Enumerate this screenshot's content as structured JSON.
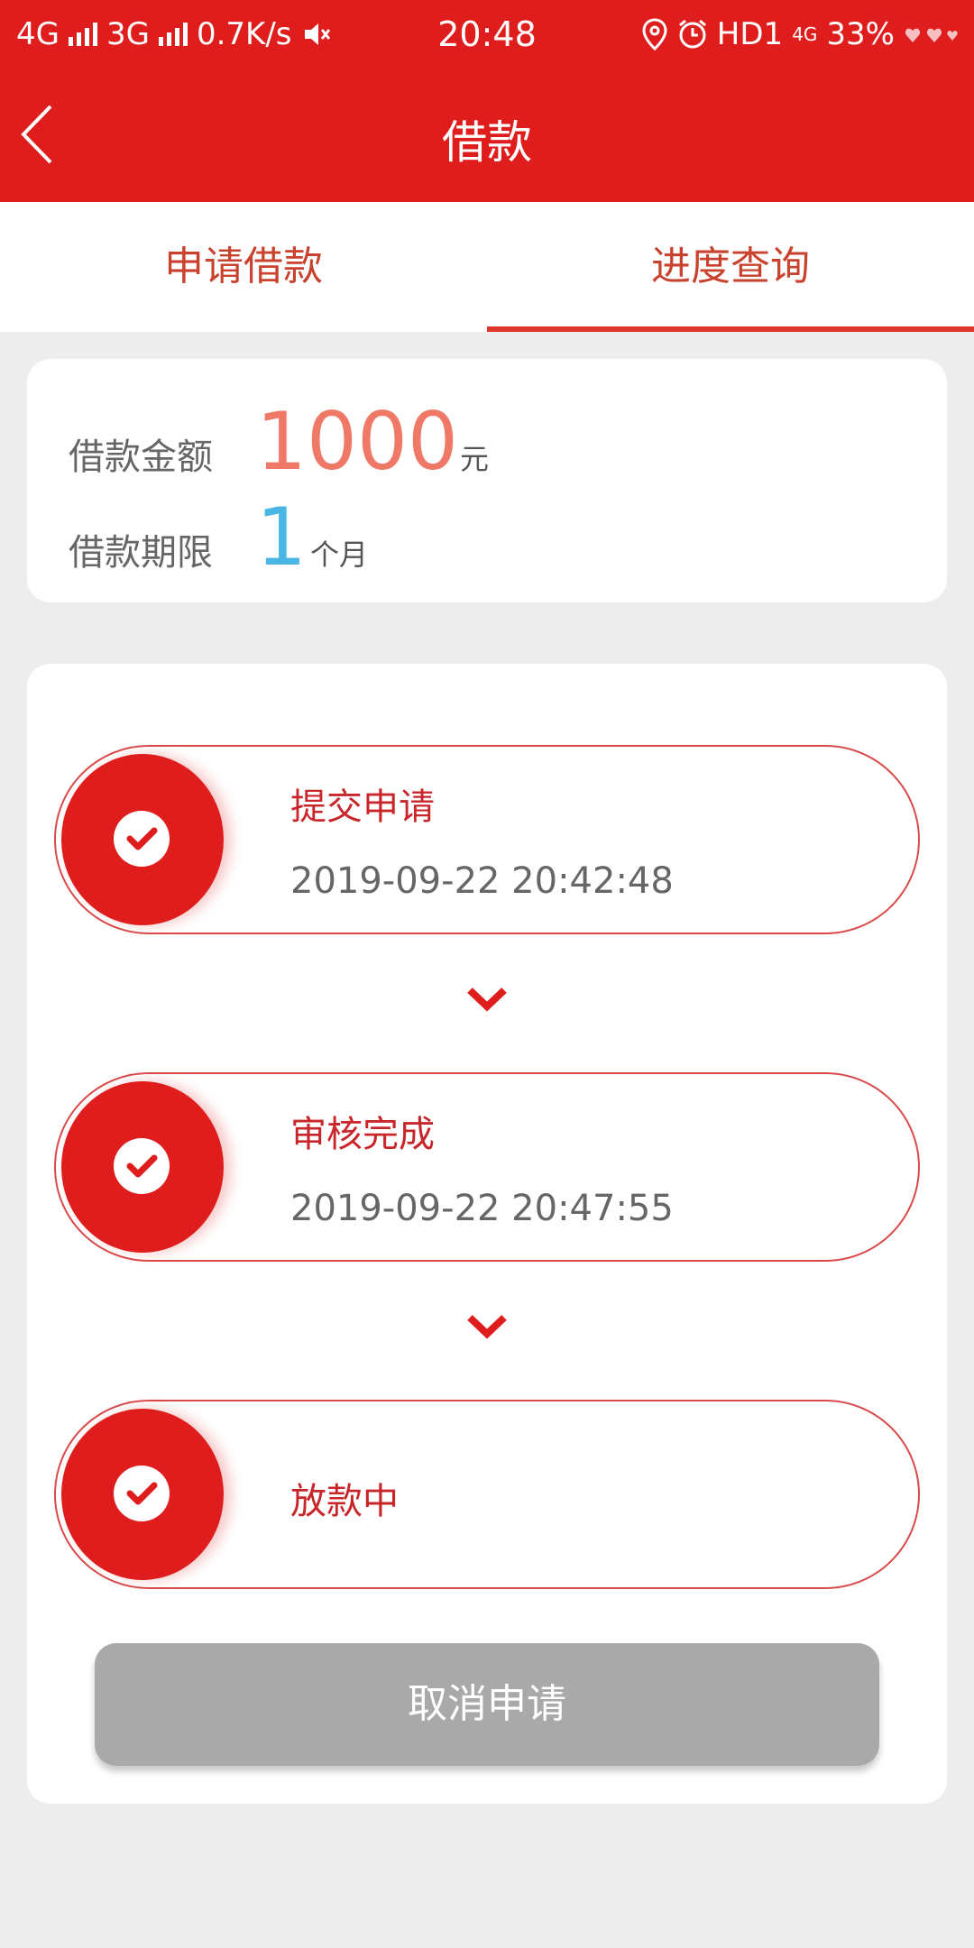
{
  "status_bar": {
    "net1": "4G",
    "net2": "3G",
    "speed": "0.7K/s",
    "time": "20:48",
    "hd": "HD1",
    "net3": "4G",
    "battery": "33%"
  },
  "header": {
    "title": "借款"
  },
  "tabs": [
    {
      "label": "申请借款",
      "active": false
    },
    {
      "label": "进度查询",
      "active": true
    }
  ],
  "loan": {
    "amount_label": "借款金额",
    "amount_value": "1000",
    "amount_unit": "元",
    "term_label": "借款期限",
    "term_value": "1",
    "term_unit": "个月"
  },
  "progress": {
    "steps": [
      {
        "title": "提交申请",
        "time": "2019-09-22 20:42:48"
      },
      {
        "title": "审核完成",
        "time": "2019-09-22 20:47:55"
      },
      {
        "title": "放款中",
        "time": ""
      }
    ]
  },
  "actions": {
    "cancel_label": "取消申请"
  },
  "colors": {
    "brand": "#e01d1d",
    "amount": "#ef7866",
    "term": "#49b6e4",
    "button_disabled": "#a9a9a9"
  },
  "icons": [
    "back-arrow-icon",
    "check-icon",
    "chevron-down-icon",
    "mute-icon",
    "location-icon",
    "alarm-icon"
  ]
}
